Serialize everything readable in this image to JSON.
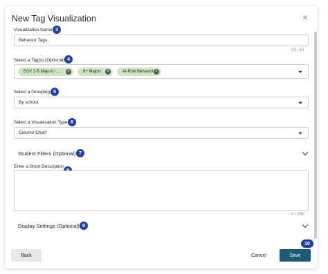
{
  "dialog": {
    "title": "New Tag Visualization",
    "close_symbol": "×"
  },
  "name_field": {
    "label": "Visualization Name",
    "badge": "3",
    "value": "Behavior Tags",
    "counter": "13 / 50"
  },
  "tags_field": {
    "label": "Select a Tag(s) (Optional)",
    "badge": "4",
    "tags": [
      {
        "label": "EOY 2-5 Majors / ..."
      },
      {
        "label": "6+ Majors"
      },
      {
        "label": "At-Risk Behavior"
      }
    ],
    "remove_symbol": "×"
  },
  "grouping_field": {
    "label": "Select a Grouping",
    "badge": "5",
    "value": "By school"
  },
  "type_field": {
    "label": "Select a Visualization Type",
    "badge": "6",
    "value": "Column Chart"
  },
  "student_filters": {
    "label": "Student Filters (Optional)",
    "badge": "7"
  },
  "description_field": {
    "label": "Enter a Short Description",
    "badge": "8",
    "value": "",
    "counter": "0 / 255"
  },
  "display_settings": {
    "label": "Display Settings (Optional)",
    "badge": "9"
  },
  "footer": {
    "back_label": "Back",
    "cancel_label": "Cancel",
    "save_label": "Save",
    "save_badge": "10"
  },
  "colors": {
    "badge": "#1f3fa6",
    "tag": "#cfe6c5",
    "save": "#1d5a74"
  }
}
